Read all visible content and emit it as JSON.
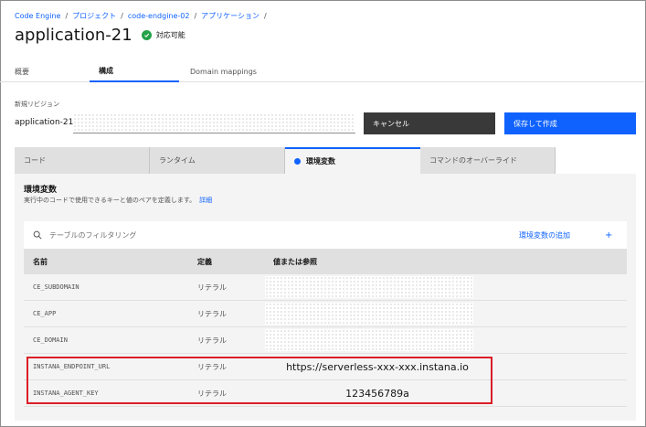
{
  "breadcrumb": [
    "Code Engine",
    "プロジェクト",
    "code-endgine-02",
    "アプリケーション"
  ],
  "breadcrumb_sep": "/",
  "page": {
    "title": "application-21",
    "status": "対応可能"
  },
  "top_tabs": [
    "概要",
    "構成",
    "Domain mappings"
  ],
  "revision": {
    "label": "新規リビジョン",
    "prefix": "application-21-"
  },
  "buttons": {
    "cancel": "キャンセル",
    "save": "保存して作成"
  },
  "sub_tabs": [
    "コード",
    "ランタイム",
    "環境変数",
    "コマンドのオーバーライド"
  ],
  "section": {
    "title": "環境変数",
    "description": "実行中のコードで使用できるキーと値のペアを定義します。",
    "link": "詳細"
  },
  "table": {
    "filter_placeholder": "テーブルのフィルタリング",
    "add_label": "環境変数の追加",
    "add_plus": "+",
    "headers": [
      "名前",
      "定義",
      "値または参照"
    ],
    "rows": [
      {
        "name": "CE_SUBDOMAIN",
        "type": "リテラル",
        "value": ""
      },
      {
        "name": "CE_APP",
        "type": "リテラル",
        "value": ""
      },
      {
        "name": "CE_DOMAIN",
        "type": "リテラル",
        "value": ""
      },
      {
        "name": "INSTANA_ENDPOINT_URL",
        "type": "リテラル",
        "value": "https://serverless-xxx-xxx.instana.io"
      },
      {
        "name": "INSTANA_AGENT_KEY",
        "type": "リテラル",
        "value": "123456789a"
      }
    ]
  },
  "colors": {
    "accent": "#0f62fe",
    "success": "#24a148",
    "highlight": "#da1e28"
  }
}
